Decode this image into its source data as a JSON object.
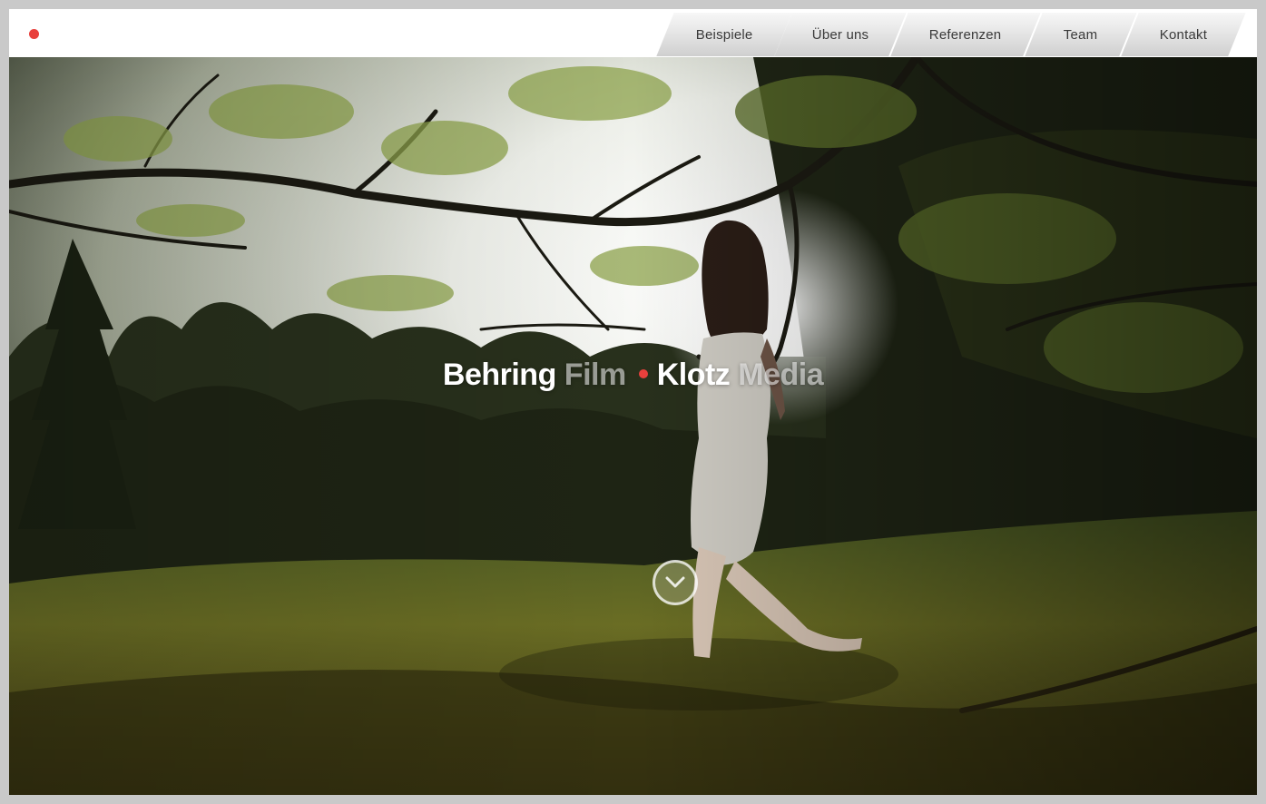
{
  "nav": {
    "items": [
      {
        "label": "Beispiele"
      },
      {
        "label": "Über uns"
      },
      {
        "label": "Referenzen"
      },
      {
        "label": "Team"
      },
      {
        "label": "Kontakt"
      }
    ]
  },
  "hero": {
    "title_part1_main": "Behring",
    "title_part1_sub": "Film",
    "title_part2_main": "Klotz",
    "title_part2_sub": "Media",
    "scroll_icon": "chevron-down-icon"
  },
  "colors": {
    "accent": "#e8403c",
    "nav_text": "#3a3a3a",
    "frame": "#c9c9c9"
  }
}
